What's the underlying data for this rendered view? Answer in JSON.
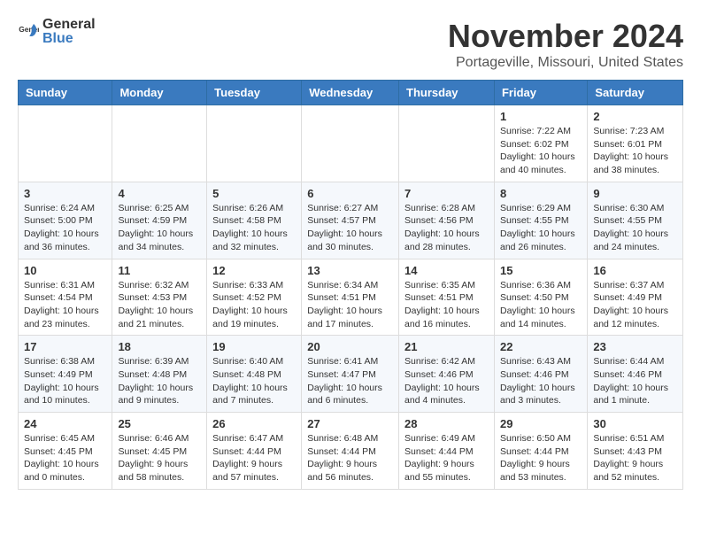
{
  "header": {
    "logo_general": "General",
    "logo_blue": "Blue",
    "month": "November 2024",
    "location": "Portageville, Missouri, United States"
  },
  "days_of_week": [
    "Sunday",
    "Monday",
    "Tuesday",
    "Wednesday",
    "Thursday",
    "Friday",
    "Saturday"
  ],
  "weeks": [
    [
      {
        "day": "",
        "info": ""
      },
      {
        "day": "",
        "info": ""
      },
      {
        "day": "",
        "info": ""
      },
      {
        "day": "",
        "info": ""
      },
      {
        "day": "",
        "info": ""
      },
      {
        "day": "1",
        "info": "Sunrise: 7:22 AM\nSunset: 6:02 PM\nDaylight: 10 hours and 40 minutes."
      },
      {
        "day": "2",
        "info": "Sunrise: 7:23 AM\nSunset: 6:01 PM\nDaylight: 10 hours and 38 minutes."
      }
    ],
    [
      {
        "day": "3",
        "info": "Sunrise: 6:24 AM\nSunset: 5:00 PM\nDaylight: 10 hours and 36 minutes."
      },
      {
        "day": "4",
        "info": "Sunrise: 6:25 AM\nSunset: 4:59 PM\nDaylight: 10 hours and 34 minutes."
      },
      {
        "day": "5",
        "info": "Sunrise: 6:26 AM\nSunset: 4:58 PM\nDaylight: 10 hours and 32 minutes."
      },
      {
        "day": "6",
        "info": "Sunrise: 6:27 AM\nSunset: 4:57 PM\nDaylight: 10 hours and 30 minutes."
      },
      {
        "day": "7",
        "info": "Sunrise: 6:28 AM\nSunset: 4:56 PM\nDaylight: 10 hours and 28 minutes."
      },
      {
        "day": "8",
        "info": "Sunrise: 6:29 AM\nSunset: 4:55 PM\nDaylight: 10 hours and 26 minutes."
      },
      {
        "day": "9",
        "info": "Sunrise: 6:30 AM\nSunset: 4:55 PM\nDaylight: 10 hours and 24 minutes."
      }
    ],
    [
      {
        "day": "10",
        "info": "Sunrise: 6:31 AM\nSunset: 4:54 PM\nDaylight: 10 hours and 23 minutes."
      },
      {
        "day": "11",
        "info": "Sunrise: 6:32 AM\nSunset: 4:53 PM\nDaylight: 10 hours and 21 minutes."
      },
      {
        "day": "12",
        "info": "Sunrise: 6:33 AM\nSunset: 4:52 PM\nDaylight: 10 hours and 19 minutes."
      },
      {
        "day": "13",
        "info": "Sunrise: 6:34 AM\nSunset: 4:51 PM\nDaylight: 10 hours and 17 minutes."
      },
      {
        "day": "14",
        "info": "Sunrise: 6:35 AM\nSunset: 4:51 PM\nDaylight: 10 hours and 16 minutes."
      },
      {
        "day": "15",
        "info": "Sunrise: 6:36 AM\nSunset: 4:50 PM\nDaylight: 10 hours and 14 minutes."
      },
      {
        "day": "16",
        "info": "Sunrise: 6:37 AM\nSunset: 4:49 PM\nDaylight: 10 hours and 12 minutes."
      }
    ],
    [
      {
        "day": "17",
        "info": "Sunrise: 6:38 AM\nSunset: 4:49 PM\nDaylight: 10 hours and 10 minutes."
      },
      {
        "day": "18",
        "info": "Sunrise: 6:39 AM\nSunset: 4:48 PM\nDaylight: 10 hours and 9 minutes."
      },
      {
        "day": "19",
        "info": "Sunrise: 6:40 AM\nSunset: 4:48 PM\nDaylight: 10 hours and 7 minutes."
      },
      {
        "day": "20",
        "info": "Sunrise: 6:41 AM\nSunset: 4:47 PM\nDaylight: 10 hours and 6 minutes."
      },
      {
        "day": "21",
        "info": "Sunrise: 6:42 AM\nSunset: 4:46 PM\nDaylight: 10 hours and 4 minutes."
      },
      {
        "day": "22",
        "info": "Sunrise: 6:43 AM\nSunset: 4:46 PM\nDaylight: 10 hours and 3 minutes."
      },
      {
        "day": "23",
        "info": "Sunrise: 6:44 AM\nSunset: 4:46 PM\nDaylight: 10 hours and 1 minute."
      }
    ],
    [
      {
        "day": "24",
        "info": "Sunrise: 6:45 AM\nSunset: 4:45 PM\nDaylight: 10 hours and 0 minutes."
      },
      {
        "day": "25",
        "info": "Sunrise: 6:46 AM\nSunset: 4:45 PM\nDaylight: 9 hours and 58 minutes."
      },
      {
        "day": "26",
        "info": "Sunrise: 6:47 AM\nSunset: 4:44 PM\nDaylight: 9 hours and 57 minutes."
      },
      {
        "day": "27",
        "info": "Sunrise: 6:48 AM\nSunset: 4:44 PM\nDaylight: 9 hours and 56 minutes."
      },
      {
        "day": "28",
        "info": "Sunrise: 6:49 AM\nSunset: 4:44 PM\nDaylight: 9 hours and 55 minutes."
      },
      {
        "day": "29",
        "info": "Sunrise: 6:50 AM\nSunset: 4:44 PM\nDaylight: 9 hours and 53 minutes."
      },
      {
        "day": "30",
        "info": "Sunrise: 6:51 AM\nSunset: 4:43 PM\nDaylight: 9 hours and 52 minutes."
      }
    ]
  ]
}
